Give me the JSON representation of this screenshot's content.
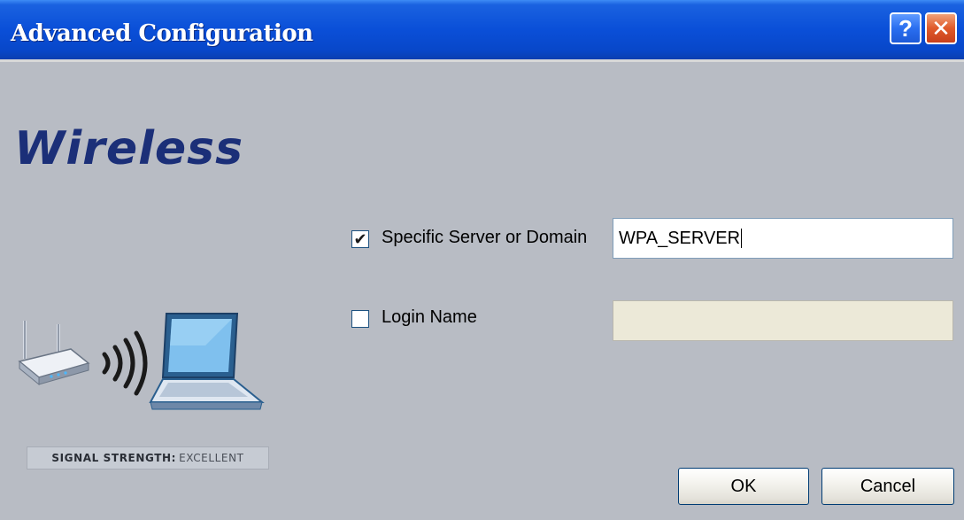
{
  "window": {
    "title": "Advanced Configuration"
  },
  "titlebar_buttons": {
    "help_label": "?",
    "close_label": "✕"
  },
  "sidebar": {
    "brand": "Wireless",
    "signal_label": "SIGNAL STRENGTH:",
    "signal_value": "EXCELLENT"
  },
  "form": {
    "server": {
      "checked": true,
      "check_glyph": "✔",
      "label": "Specific Server or Domain",
      "value": "WPA_SERVER"
    },
    "login": {
      "checked": false,
      "check_glyph": "",
      "label": "Login Name",
      "value": ""
    }
  },
  "buttons": {
    "ok": "OK",
    "cancel": "Cancel"
  },
  "colors": {
    "titlebar": "#0a4fd8",
    "dialog_bg": "#b8bcc4",
    "brand": "#1b2f78",
    "disabled_input": "#ece9d8"
  }
}
